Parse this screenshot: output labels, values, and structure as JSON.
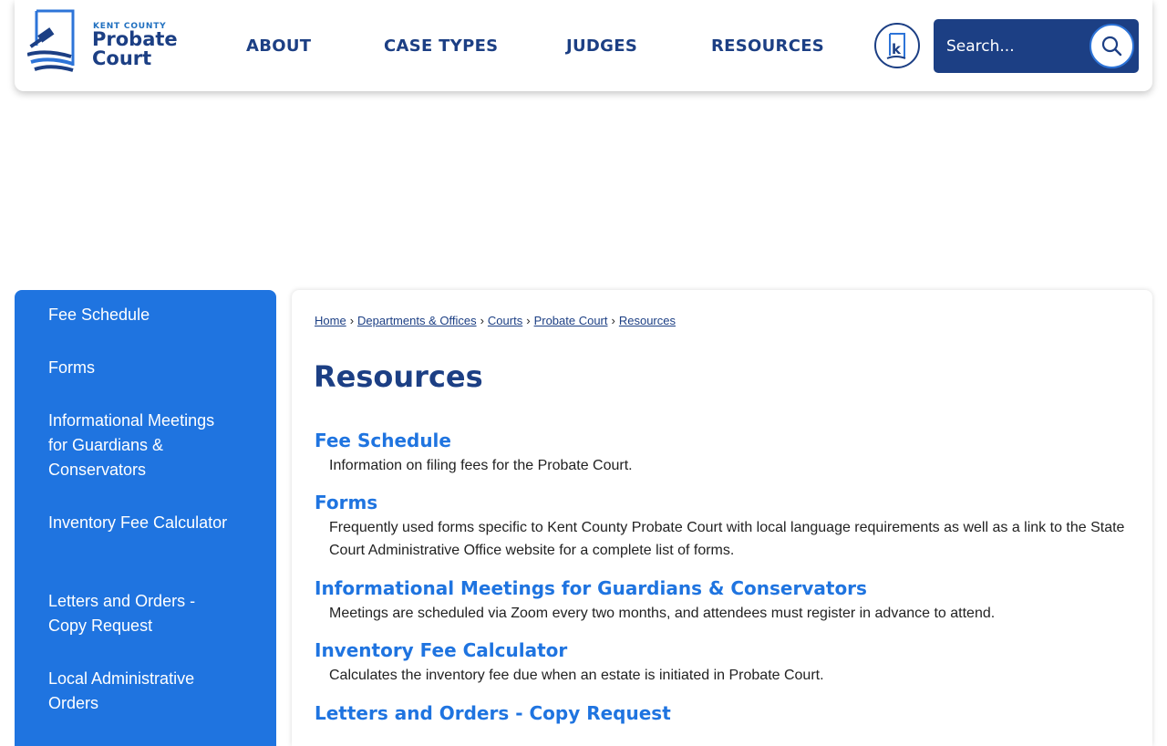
{
  "header": {
    "logo": {
      "line1": "KENT COUNTY",
      "line2": "Probate",
      "line3": "Court"
    },
    "nav": [
      "ABOUT",
      "CASE TYPES",
      "JUDGES",
      "RESOURCES"
    ],
    "search": {
      "placeholder": "Search..."
    }
  },
  "sidebar": {
    "items": [
      {
        "label": "Fee Schedule"
      },
      {
        "label": "Forms"
      },
      {
        "label": "Informational Meetings for Guardians & Conservators"
      },
      {
        "label": "Inventory Fee Calculator"
      },
      {
        "label": "Letters and Orders - Copy Request"
      },
      {
        "label": "Local Administrative Orders"
      }
    ]
  },
  "breadcrumb": {
    "items": [
      "Home",
      "Departments & Offices",
      "Courts",
      "Probate Court",
      "Resources"
    ],
    "sep": "›"
  },
  "page": {
    "title": "Resources"
  },
  "resources": [
    {
      "title": "Fee Schedule",
      "desc": "Information on filing fees for the Probate Court."
    },
    {
      "title": "Forms",
      "desc": "Frequently used forms specific to Kent County Probate Court with local language requirements as well as a link to the State Court Administrative Office website for a complete list of forms."
    },
    {
      "title": "Informational Meetings for Guardians & Conservators",
      "desc": "Meetings are scheduled via Zoom every two months, and attendees must register in advance to attend."
    },
    {
      "title": "Inventory Fee Calculator",
      "desc": "Calculates the inventory fee due when an estate is initiated in Probate Court."
    },
    {
      "title": "Letters and Orders - Copy Request",
      "desc": ""
    }
  ],
  "colors": {
    "navy": "#1c3f84",
    "blue": "#1f74e0"
  }
}
